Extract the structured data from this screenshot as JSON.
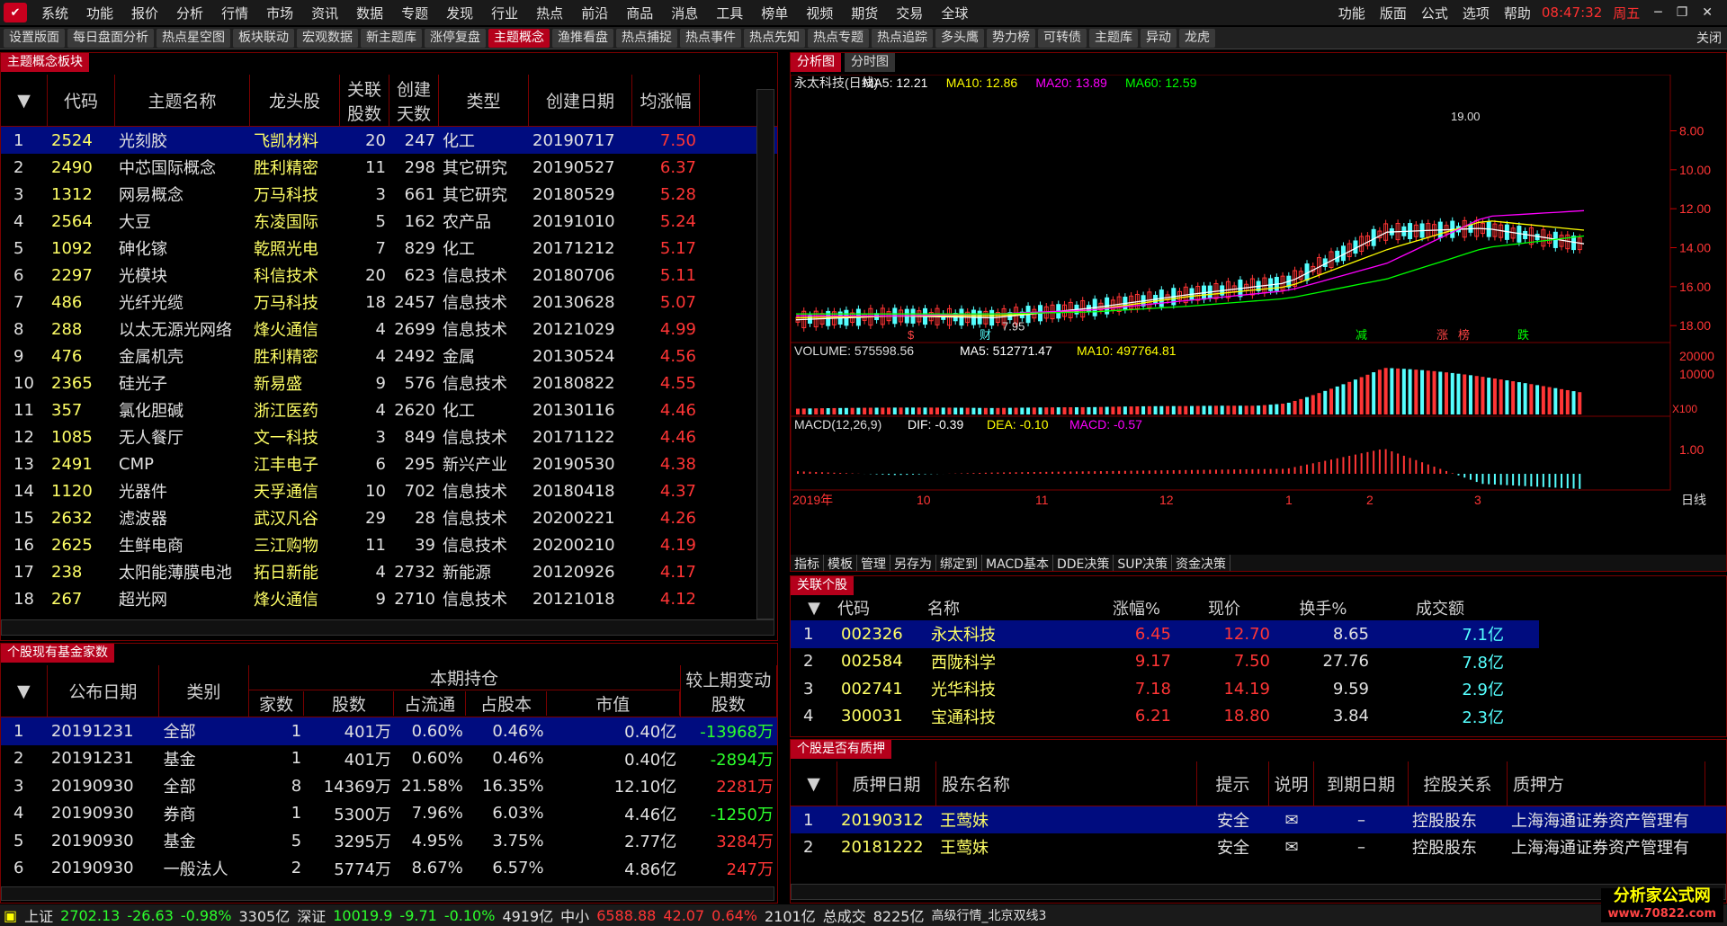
{
  "menu": [
    "系统",
    "功能",
    "报价",
    "分析",
    "行情",
    "市场",
    "资讯",
    "数据",
    "专题",
    "发现",
    "行业",
    "热点",
    "前沿",
    "商品",
    "消息",
    "工具",
    "榜单",
    "视频",
    "期货",
    "交易",
    "全球"
  ],
  "menu_right": [
    "功能",
    "版面",
    "公式",
    "选项",
    "帮助"
  ],
  "clock": "08:47:32",
  "weekday": "周五",
  "tabs": [
    "设置版面",
    "每日盘面分析",
    "热点星空图",
    "板块联动",
    "宏观数据",
    "新主题库",
    "涨停复盘",
    "主题概念",
    "渔推看盘",
    "热点捕捉",
    "热点事件",
    "热点先知",
    "热点专题",
    "热点追踪",
    "多头鹰",
    "势力榜",
    "可转债",
    "主题库",
    "异动",
    "龙虎"
  ],
  "tab_close": "关闭",
  "theme": {
    "title": "主题概念板块",
    "headers": {
      "code": "代码",
      "name": "主题名称",
      "leader": "龙头股",
      "rel1": "关联",
      "rel2": "股数",
      "cre1": "创建",
      "cre2": "天数",
      "type": "类型",
      "date": "创建日期",
      "avg": "均涨幅"
    },
    "rows": [
      [
        "1",
        "2524",
        "光刻胶",
        "飞凯材料",
        "20",
        "247",
        "化工",
        "20190717",
        "7.50"
      ],
      [
        "2",
        "2490",
        "中芯国际概念",
        "胜利精密",
        "11",
        "298",
        "其它研究",
        "20190527",
        "6.37"
      ],
      [
        "3",
        "1312",
        "网易概念",
        "万马科技",
        "3",
        "661",
        "其它研究",
        "20180529",
        "5.28"
      ],
      [
        "4",
        "2564",
        "大豆",
        "东凌国际",
        "5",
        "162",
        "农产品",
        "20191010",
        "5.24"
      ],
      [
        "5",
        "1092",
        "砷化镓",
        "乾照光电",
        "7",
        "829",
        "化工",
        "20171212",
        "5.17"
      ],
      [
        "6",
        "2297",
        "光模块",
        "科信技术",
        "20",
        "623",
        "信息技术",
        "20180706",
        "5.11"
      ],
      [
        "7",
        "486",
        "光纤光缆",
        "万马科技",
        "18",
        "2457",
        "信息技术",
        "20130628",
        "5.07"
      ],
      [
        "8",
        "288",
        "以太无源光网络",
        "烽火通信",
        "4",
        "2699",
        "信息技术",
        "20121029",
        "4.99"
      ],
      [
        "9",
        "476",
        "金属机壳",
        "胜利精密",
        "4",
        "2492",
        "金属",
        "20130524",
        "4.56"
      ],
      [
        "10",
        "2365",
        "硅光子",
        "新易盛",
        "9",
        "576",
        "信息技术",
        "20180822",
        "4.55"
      ],
      [
        "11",
        "357",
        "氯化胆碱",
        "浙江医药",
        "4",
        "2620",
        "化工",
        "20130116",
        "4.46"
      ],
      [
        "12",
        "1085",
        "无人餐厅",
        "文一科技",
        "3",
        "849",
        "信息技术",
        "20171122",
        "4.46"
      ],
      [
        "13",
        "2491",
        "CMP",
        "江丰电子",
        "6",
        "295",
        "新兴产业",
        "20190530",
        "4.38"
      ],
      [
        "14",
        "1120",
        "光器件",
        "天孚通信",
        "10",
        "702",
        "信息技术",
        "20180418",
        "4.37"
      ],
      [
        "15",
        "2632",
        "滤波器",
        "武汉凡谷",
        "29",
        "28",
        "信息技术",
        "20200221",
        "4.26"
      ],
      [
        "16",
        "2625",
        "生鲜电商",
        "三江购物",
        "11",
        "39",
        "信息技术",
        "20200210",
        "4.19"
      ],
      [
        "17",
        "238",
        "太阳能薄膜电池",
        "拓日新能",
        "4",
        "2732",
        "新能源",
        "20120926",
        "4.17"
      ],
      [
        "18",
        "267",
        "超光网",
        "烽火通信",
        "9",
        "2710",
        "信息技术",
        "20121018",
        "4.12"
      ]
    ]
  },
  "fund": {
    "title": "个股现有基金家数",
    "headers": {
      "date": "公布日期",
      "cat": "类别",
      "cur": "本期持仓",
      "count": "家数",
      "shares": "股数",
      "float": "占流通",
      "total": "占股本",
      "mv": "市值",
      "chg": "较上期变动",
      "chg2": "股数"
    },
    "rows": [
      [
        "1",
        "20191231",
        "全部",
        "1",
        "401万",
        "0.60%",
        "0.46%",
        "0.40亿",
        "-13968万"
      ],
      [
        "2",
        "20191231",
        "基金",
        "1",
        "401万",
        "0.60%",
        "0.46%",
        "0.40亿",
        "-2894万"
      ],
      [
        "3",
        "20190930",
        "全部",
        "8",
        "14369万",
        "21.58%",
        "16.35%",
        "12.10亿",
        "2281万"
      ],
      [
        "4",
        "20190930",
        "券商",
        "1",
        "5300万",
        "7.96%",
        "6.03%",
        "4.46亿",
        "-1250万"
      ],
      [
        "5",
        "20190930",
        "基金",
        "5",
        "3295万",
        "4.95%",
        "3.75%",
        "2.77亿",
        "3284万"
      ],
      [
        "6",
        "20190930",
        "一般法人",
        "2",
        "5774万",
        "8.67%",
        "6.57%",
        "4.86亿",
        "247万"
      ]
    ]
  },
  "chart_tabs": [
    "分析图",
    "分时图"
  ],
  "kline": {
    "title": "永太科技(日线)",
    "ma5": "MA5: 12.21",
    "ma10": "MA10: 12.86",
    "ma20": "MA20: 13.89",
    "ma60": "MA60: 12.59",
    "high_label": "19.00",
    "low_label": "7.95",
    "yticks": [
      "18.00",
      "16.00",
      "14.00",
      "12.00",
      "10.00",
      "8.00"
    ],
    "markers": [
      "$",
      "财",
      "减",
      "涨",
      "榜",
      "跌"
    ]
  },
  "volume": {
    "label": "VOLUME: 575598.56",
    "ma5": "MA5: 512771.47",
    "ma10": "MA10: 497764.81",
    "yticks": [
      "20000",
      "10000"
    ],
    "unit": "X100"
  },
  "macd": {
    "label": "MACD(12,26,9)",
    "dif": "DIF: -0.39",
    "dea": "DEA: -0.10",
    "macd": "MACD: -0.57",
    "ytick": "1.00"
  },
  "xaxis": [
    "2019年",
    "10",
    "11",
    "12",
    "1",
    "2",
    "3"
  ],
  "xaxis_right": "日线",
  "chart_toolbar": [
    "指标",
    "模板",
    "管理",
    "另存为",
    "绑定到",
    "MACD基本",
    "DDE决策",
    "SUP决策",
    "资金决策"
  ],
  "chart_data": {
    "type": "line",
    "title": "永太科技(日线)",
    "ylim": [
      7.5,
      19.5
    ],
    "yticks": [
      8,
      10,
      12,
      14,
      16,
      18
    ],
    "x": [
      "2019年",
      "10",
      "11",
      "12",
      "1",
      "2",
      "3"
    ],
    "series": [
      {
        "name": "MA5",
        "values": [
          8.3,
          8.5,
          8.4,
          8.9,
          9.6,
          10.2,
          12.8,
          13.0,
          12.2
        ]
      },
      {
        "name": "MA10",
        "values": [
          8.4,
          8.5,
          8.5,
          8.8,
          9.5,
          10.0,
          11.9,
          13.4,
          12.9
        ]
      },
      {
        "name": "MA20",
        "values": [
          8.5,
          8.5,
          8.6,
          8.8,
          9.3,
          9.8,
          11.2,
          13.6,
          13.9
        ]
      },
      {
        "name": "MA60",
        "values": [
          8.6,
          8.6,
          8.6,
          8.7,
          9.0,
          9.4,
          10.4,
          12.0,
          12.6
        ]
      }
    ]
  },
  "related": {
    "title": "关联个股",
    "headers": [
      "代码",
      "名称",
      "涨幅%",
      "现价",
      "换手%",
      "成交额"
    ],
    "rows": [
      [
        "1",
        "002326",
        "永太科技",
        "6.45",
        "12.70",
        "8.65",
        "7.1亿"
      ],
      [
        "2",
        "002584",
        "西陇科学",
        "9.17",
        "7.50",
        "27.76",
        "7.8亿"
      ],
      [
        "3",
        "002741",
        "光华科技",
        "7.18",
        "14.19",
        "9.59",
        "2.9亿"
      ],
      [
        "4",
        "300031",
        "宝通科技",
        "6.21",
        "18.80",
        "3.84",
        "2.3亿"
      ]
    ]
  },
  "pledge": {
    "title": "个股是否有质押",
    "headers": [
      "质押日期",
      "股东名称",
      "提示",
      "说明",
      "到期日期",
      "控股关系",
      "质押方"
    ],
    "rows": [
      [
        "1",
        "20190312",
        "王莺妹",
        "安全",
        "✉",
        "–",
        "控股股东",
        "上海海通证券资产管理有"
      ],
      [
        "2",
        "20181222",
        "王莺妹",
        "安全",
        "✉",
        "–",
        "控股股东",
        "上海海通证券资产管理有"
      ]
    ]
  },
  "status": {
    "sh_name": "上证",
    "sh_val": "2702.13",
    "sh_chg": "-26.63",
    "sh_pct": "-0.98%",
    "sh_amt": "3305亿",
    "sz_name": "深证",
    "sz_val": "10019.9",
    "sz_chg": "-9.71",
    "sz_pct": "-0.10%",
    "sz_amt": "4919亿",
    "zx_name": "中小",
    "zx_val": "6588.88",
    "zx_chg": "42.07",
    "zx_pct": "0.64%",
    "zx_amt": "2101亿",
    "total_name": "总成交",
    "total_amt": "8225亿",
    "server": "高级行情_北京双线3",
    "watermark": "分析家公式网",
    "watermark_url": "www.70822.com"
  }
}
